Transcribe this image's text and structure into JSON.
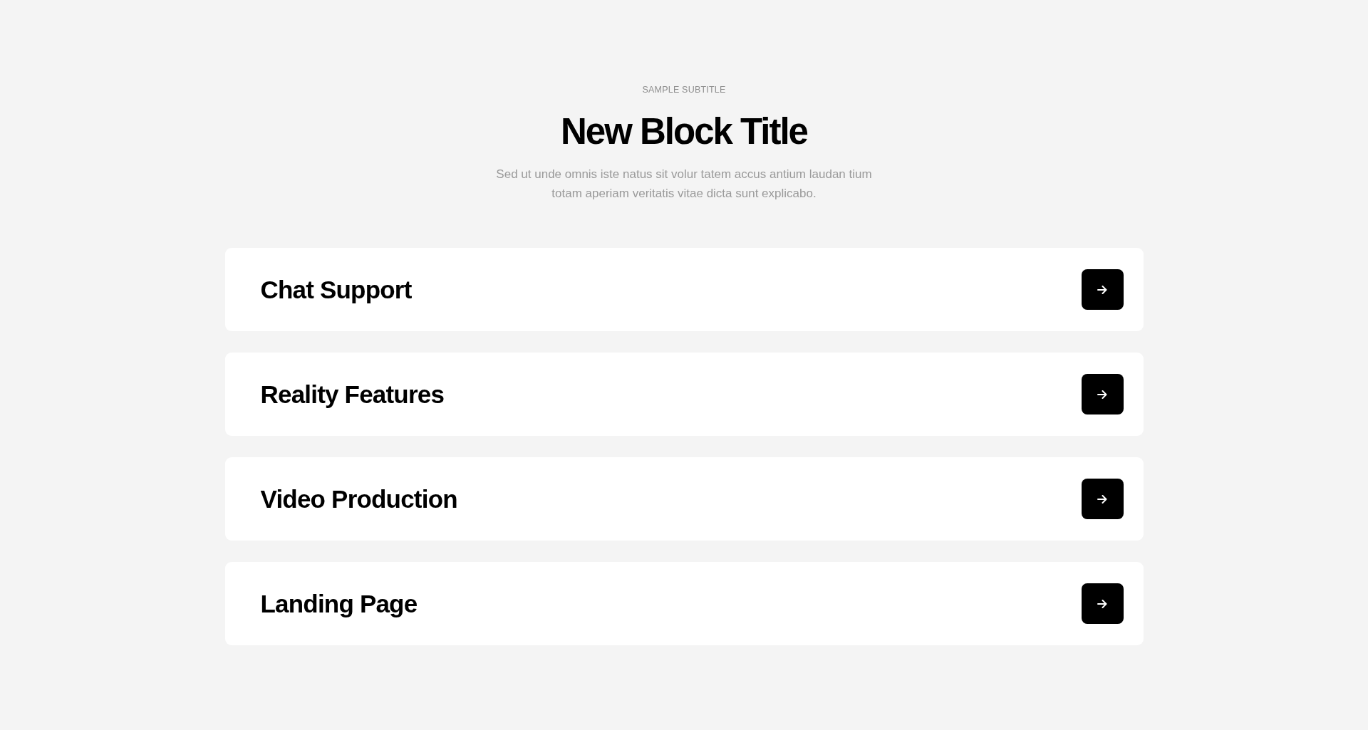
{
  "header": {
    "subtitle": "SAMPLE SUBTITLE",
    "title": "New Block Title",
    "description": "Sed ut unde omnis iste natus sit volur tatem accus antium laudan tium totam aperiam veritatis vitae dicta sunt explicabo."
  },
  "items": [
    {
      "title": "Chat Support"
    },
    {
      "title": "Reality Features"
    },
    {
      "title": "Video Production"
    },
    {
      "title": "Landing Page"
    }
  ]
}
